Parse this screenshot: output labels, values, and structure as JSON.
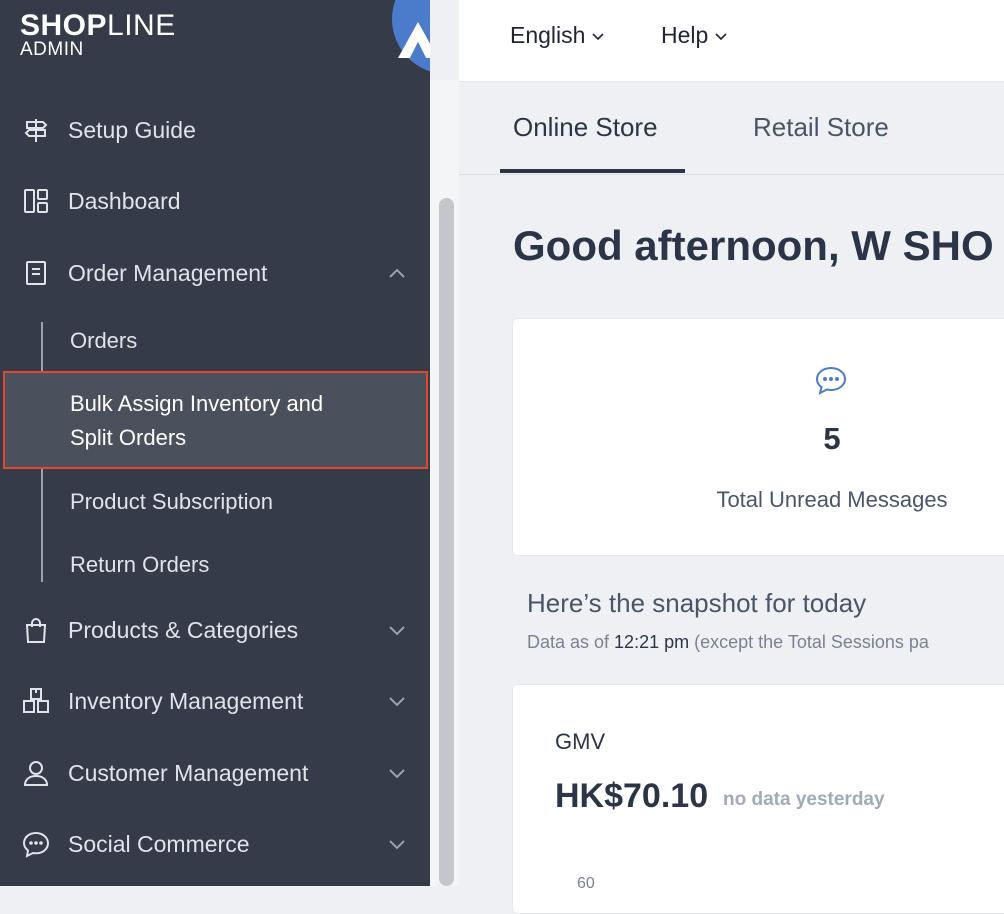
{
  "logo": {
    "brand_bold": "SHOP",
    "brand_thin": "LINE",
    "sub": "ADMIN"
  },
  "sidebar": {
    "items": [
      {
        "label": "Setup Guide",
        "icon": "signpost-icon"
      },
      {
        "label": "Dashboard",
        "icon": "dashboard-icon"
      },
      {
        "label": "Order Management",
        "icon": "clipboard-icon",
        "expanded": true
      },
      {
        "label": "Products & Categories",
        "icon": "shopping-bag-icon"
      },
      {
        "label": "Inventory Management",
        "icon": "boxes-icon"
      },
      {
        "label": "Customer Management",
        "icon": "user-icon"
      },
      {
        "label": "Social Commerce",
        "icon": "chat-bubble-icon"
      }
    ],
    "order_sub_items": [
      {
        "label": "Orders"
      },
      {
        "label_line1": "Bulk Assign Inventory and",
        "label_line2": "Split Orders",
        "highlighted": true
      },
      {
        "label": "Product Subscription"
      },
      {
        "label": "Return Orders"
      }
    ]
  },
  "header": {
    "language": "English",
    "help": "Help"
  },
  "tabs": [
    {
      "label": "Online Store",
      "active": true
    },
    {
      "label": "Retail Store"
    }
  ],
  "greeting": "Good afternoon, W SHO",
  "messages": {
    "count": "5",
    "label": "Total Unread Messages"
  },
  "snapshot": {
    "title": "Here’s the snapshot for today",
    "sub_prefix": "Data as of ",
    "time": "12:21 pm",
    "sub_suffix": " (except the Total Sessions pa"
  },
  "gmv": {
    "label": "GMV",
    "value": "HK$70.10",
    "note": "no data yesterday",
    "axis_tick": "60"
  },
  "colors": {
    "sidebar_bg": "#363b4a",
    "highlight_border": "#e1472b",
    "accent_blue": "#4b7bcb"
  }
}
